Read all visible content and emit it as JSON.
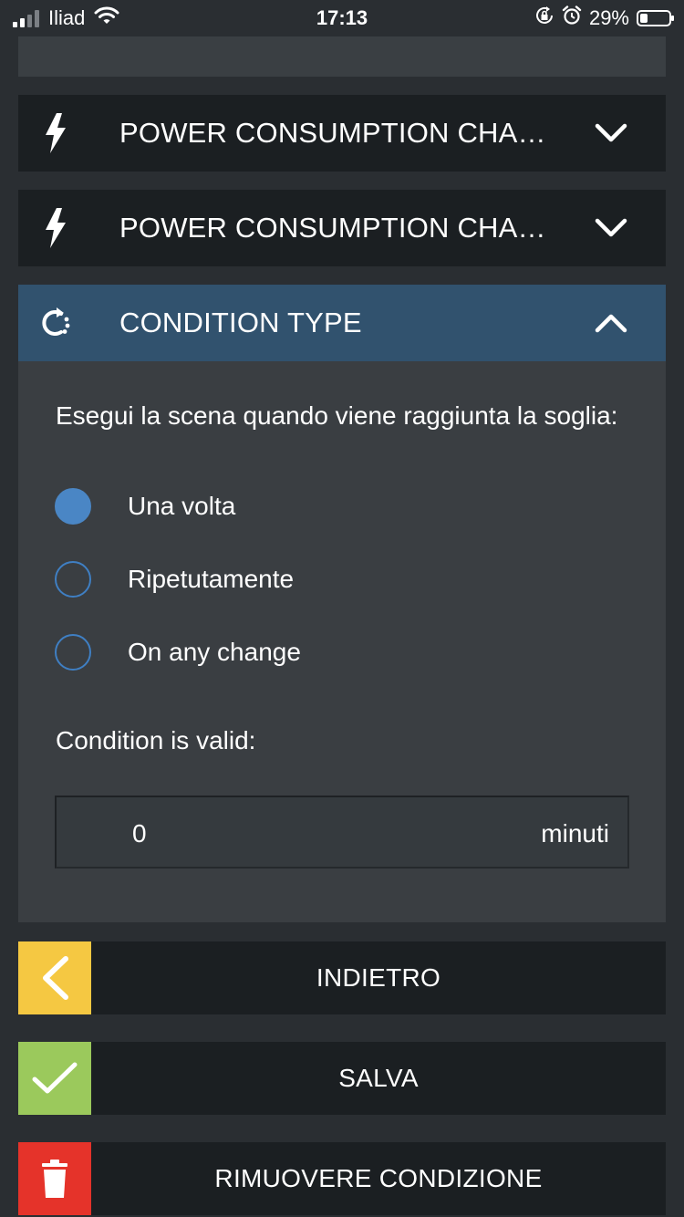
{
  "status_bar": {
    "carrier": "Iliad",
    "time": "17:13",
    "battery_percent": "29%",
    "battery_level": 0.29,
    "icons": [
      "signal-icon",
      "wifi-icon",
      "orientation-lock-icon",
      "alarm-icon",
      "battery-icon"
    ]
  },
  "accordions": [
    {
      "title": "POWER CONSUMPTION CHA…",
      "icon": "lightning-bolt-icon",
      "expanded": false
    },
    {
      "title": "POWER CONSUMPTION CHA…",
      "icon": "lightning-bolt-icon",
      "expanded": false
    },
    {
      "title": "CONDITION TYPE",
      "icon": "repeat-cycle-icon",
      "expanded": true
    }
  ],
  "condition_panel": {
    "prompt": "Esegui la scena quando viene raggiunta la soglia:",
    "options": [
      {
        "label": "Una volta",
        "selected": true
      },
      {
        "label": "Ripetutamente",
        "selected": false
      },
      {
        "label": "On any change",
        "selected": false
      }
    ],
    "valid_label": "Condition is valid:",
    "duration_value": "0",
    "duration_unit": "minuti"
  },
  "actions": {
    "back_label": "INDIETRO",
    "save_label": "SALVA",
    "remove_label": "RIMUOVERE CONDIZIONE"
  },
  "colors": {
    "background": "#2a2e32",
    "header_dark": "#1b1f22",
    "header_active": "#31526e",
    "panel": "#3a3e42",
    "radio_accent": "#4a86c5",
    "back_yellow": "#f5c842",
    "save_green": "#9bc95c",
    "remove_red": "#e5332a"
  }
}
